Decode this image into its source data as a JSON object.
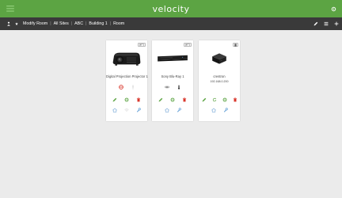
{
  "app": {
    "brand": "velocity",
    "colors": {
      "topbar": "#5ca443",
      "navbar": "#3a3a3a",
      "background": "#ebebeb",
      "edit": "#5ca443",
      "delete": "#d9362b",
      "warning": "#d9362b",
      "action": "#5b9bd5"
    }
  },
  "nav": {
    "title": "Modify Room",
    "separator": "|",
    "breadcrumb": [
      "All Sites",
      "ABC",
      "Building 1",
      "Room"
    ],
    "right_icons": [
      "edit-icon",
      "list-icon",
      "add-icon"
    ]
  },
  "devices": [
    {
      "name": "Digital Projection Projector 1",
      "ip": "",
      "badge": "icon",
      "image": "projector",
      "status_icons": [
        "warning-icon",
        "info-icon"
      ],
      "action_icons": [
        "edit-icon",
        "settings-icon",
        "delete-icon"
      ],
      "bottom_icons": [
        "home-icon",
        "wifi-icon",
        "wrench-icon"
      ]
    },
    {
      "name": "Sony Blu-Ray 1",
      "ip": "",
      "badge": "icon",
      "image": "bluray",
      "status_icons": [
        "link-icon",
        "thermometer-icon"
      ],
      "action_icons": [
        "edit-icon",
        "settings-icon",
        "delete-icon"
      ],
      "bottom_icons": [
        "home-icon",
        "wrench-icon"
      ]
    },
    {
      "name": "crestron",
      "ip": "192.168.0.200",
      "badge": "icon",
      "image": "controller",
      "status_icons": [],
      "action_icons": [
        "edit-icon",
        "refresh-icon",
        "settings-icon",
        "delete-icon"
      ],
      "bottom_icons": [
        "home-icon",
        "wrench-icon"
      ]
    }
  ]
}
